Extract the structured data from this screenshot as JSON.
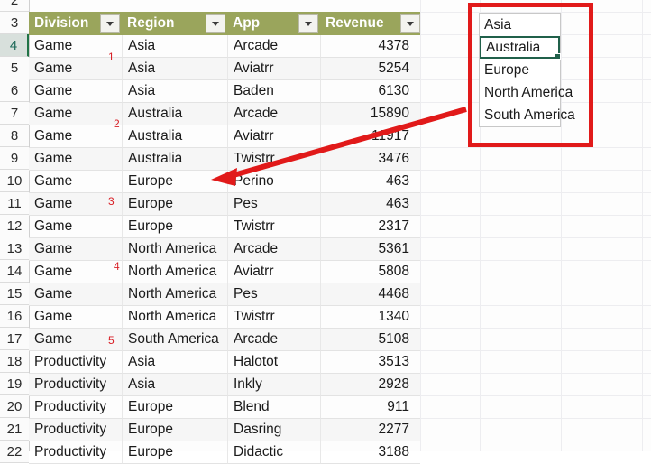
{
  "spreadsheet": {
    "row_numbers": [
      "2",
      "3",
      "4",
      "5",
      "6",
      "7",
      "8",
      "9",
      "10",
      "11",
      "12",
      "13",
      "14",
      "15",
      "16",
      "17",
      "18",
      "19",
      "20",
      "21",
      "22"
    ],
    "active_row": "4",
    "header_fill": "#9aa55c",
    "header_text_color": "#ffffff",
    "selection_color": "#20604a",
    "annotation_color": "#d81f26"
  },
  "table": {
    "headers": [
      "Division",
      "Region",
      "App",
      "Revenue"
    ],
    "filter_icon": "filter-dropdown-caret",
    "rows": [
      {
        "row": "4",
        "division": "Game",
        "region": "Asia",
        "app": "Arcade",
        "revenue": "4378"
      },
      {
        "row": "5",
        "division": "Game",
        "region": "Asia",
        "app": "Aviatrr",
        "revenue": "5254"
      },
      {
        "row": "6",
        "division": "Game",
        "region": "Asia",
        "app": "Baden",
        "revenue": "6130"
      },
      {
        "row": "7",
        "division": "Game",
        "region": "Australia",
        "app": "Arcade",
        "revenue": "15890"
      },
      {
        "row": "8",
        "division": "Game",
        "region": "Australia",
        "app": "Aviatrr",
        "revenue": "11917"
      },
      {
        "row": "9",
        "division": "Game",
        "region": "Australia",
        "app": "Twistrr",
        "revenue": "3476"
      },
      {
        "row": "10",
        "division": "Game",
        "region": "Europe",
        "app": "Perino",
        "revenue": "463"
      },
      {
        "row": "11",
        "division": "Game",
        "region": "Europe",
        "app": "Pes",
        "revenue": "463"
      },
      {
        "row": "12",
        "division": "Game",
        "region": "Europe",
        "app": "Twistrr",
        "revenue": "2317"
      },
      {
        "row": "13",
        "division": "Game",
        "region": "North America",
        "app": "Arcade",
        "revenue": "5361"
      },
      {
        "row": "14",
        "division": "Game",
        "region": "North America",
        "app": "Aviatrr",
        "revenue": "5808"
      },
      {
        "row": "15",
        "division": "Game",
        "region": "North America",
        "app": "Pes",
        "revenue": "4468"
      },
      {
        "row": "16",
        "division": "Game",
        "region": "North America",
        "app": "Twistrr",
        "revenue": "1340"
      },
      {
        "row": "17",
        "division": "Game",
        "region": "South America",
        "app": "Arcade",
        "revenue": "5108"
      },
      {
        "row": "18",
        "division": "Productivity",
        "region": "Asia",
        "app": "Halotot",
        "revenue": "3513"
      },
      {
        "row": "19",
        "division": "Productivity",
        "region": "Asia",
        "app": "Inkly",
        "revenue": "2928"
      },
      {
        "row": "20",
        "division": "Productivity",
        "region": "Europe",
        "app": "Blend",
        "revenue": "911"
      },
      {
        "row": "21",
        "division": "Productivity",
        "region": "Europe",
        "app": "Dasring",
        "revenue": "2277"
      },
      {
        "row": "22",
        "division": "Productivity",
        "region": "Europe",
        "app": "Didactic",
        "revenue": "3188"
      }
    ]
  },
  "region_list": {
    "items": [
      "Asia",
      "Australia",
      "Europe",
      "North America",
      "South America"
    ],
    "selected": "Australia"
  },
  "annotations": {
    "numbers": [
      "1",
      "2",
      "3",
      "4",
      "5"
    ],
    "arrow": "red-arrow-pointing-to-europe-row",
    "highlight_box": "red-rectangle-around-region-list"
  }
}
